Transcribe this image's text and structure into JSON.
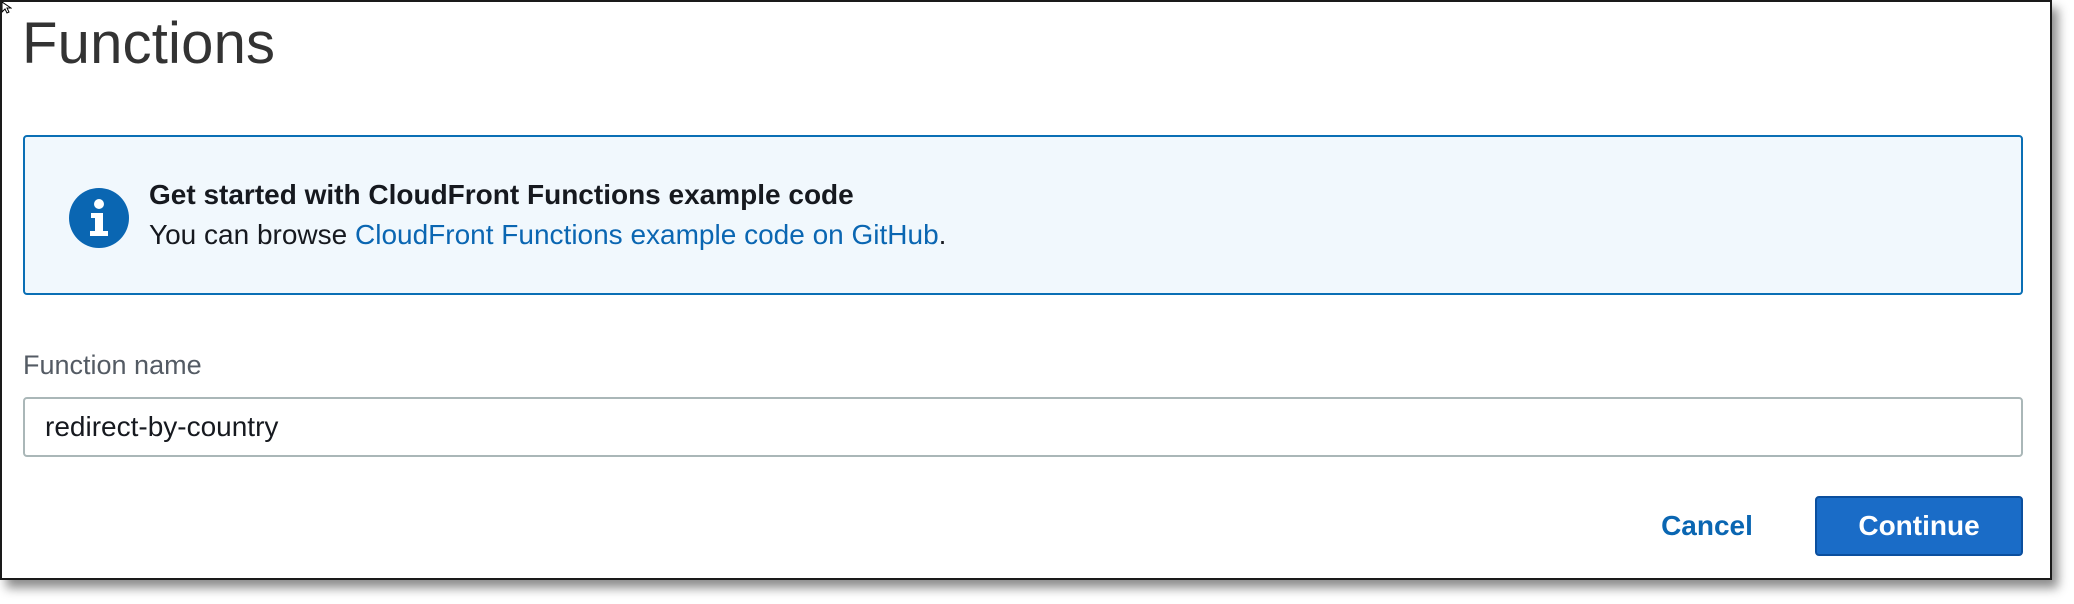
{
  "page": {
    "title": "Functions"
  },
  "info_alert": {
    "icon": "info-icon",
    "title": "Get started with CloudFront Functions example code",
    "text_prefix": "You can browse ",
    "link_text": "CloudFront Functions example code on GitHub",
    "text_suffix": "."
  },
  "form": {
    "function_name_label": "Function name",
    "function_name_value": "redirect-by-country"
  },
  "actions": {
    "cancel_label": "Cancel",
    "continue_label": "Continue"
  },
  "colors": {
    "accent": "#0a66b2",
    "primary_button": "#1a6cc7",
    "info_background": "#f1f8fd",
    "info_border": "#0a6fb5",
    "info_icon": "#0a66b2"
  }
}
